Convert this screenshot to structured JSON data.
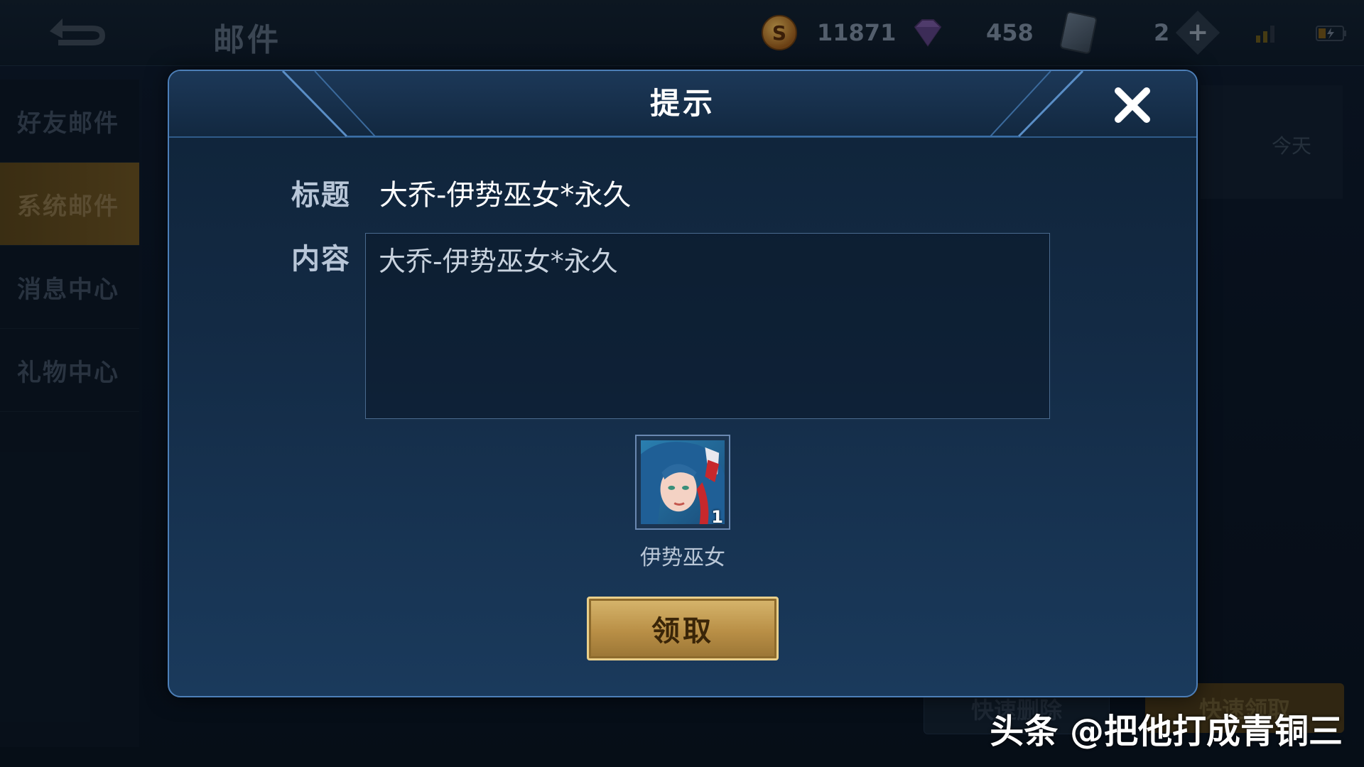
{
  "header": {
    "title": "邮件",
    "gold": "11871",
    "diamonds": "458",
    "tickets": "2"
  },
  "sidebar": {
    "items": [
      {
        "label": "好友邮件"
      },
      {
        "label": "系统邮件"
      },
      {
        "label": "消息中心"
      },
      {
        "label": "礼物中心"
      }
    ]
  },
  "background": {
    "mail_date": "今天",
    "quick_delete_label": "快速删除",
    "quick_claim_label": "快速领取"
  },
  "dialog": {
    "title": "提示",
    "title_label": "标题",
    "title_value": "大乔-伊势巫女*永久",
    "content_label": "内容",
    "content_value": "大乔-伊势巫女*永久",
    "reward": {
      "name": "伊势巫女",
      "count": "1"
    },
    "claim_label": "领取"
  },
  "watermark": "头条 @把他打成青铜三",
  "colors": {
    "accent_gold": "#c9a45a",
    "dialog_border": "#4d7fb8",
    "active_tab": "#6e5420"
  }
}
